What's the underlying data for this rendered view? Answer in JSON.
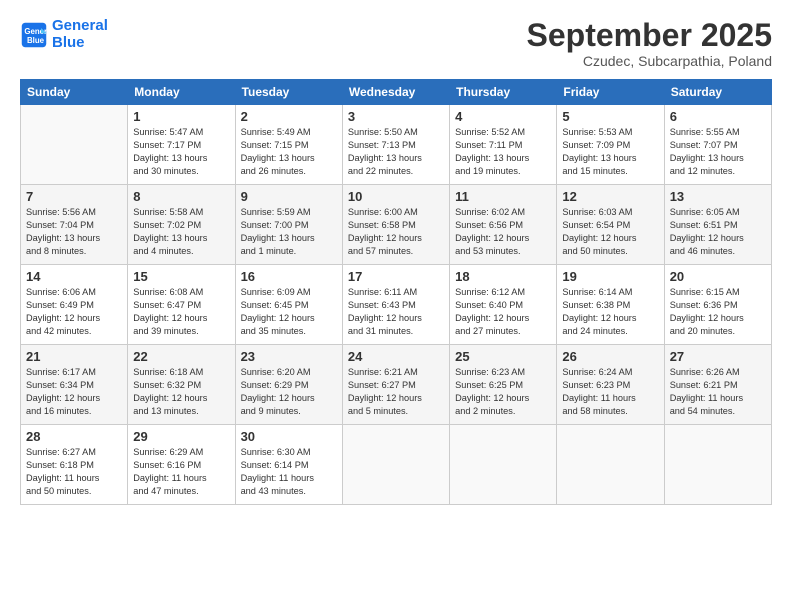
{
  "logo": {
    "line1": "General",
    "line2": "Blue"
  },
  "title": "September 2025",
  "subtitle": "Czudec, Subcarpathia, Poland",
  "days_of_week": [
    "Sunday",
    "Monday",
    "Tuesday",
    "Wednesday",
    "Thursday",
    "Friday",
    "Saturday"
  ],
  "weeks": [
    [
      {
        "day": "",
        "info": ""
      },
      {
        "day": "1",
        "info": "Sunrise: 5:47 AM\nSunset: 7:17 PM\nDaylight: 13 hours\nand 30 minutes."
      },
      {
        "day": "2",
        "info": "Sunrise: 5:49 AM\nSunset: 7:15 PM\nDaylight: 13 hours\nand 26 minutes."
      },
      {
        "day": "3",
        "info": "Sunrise: 5:50 AM\nSunset: 7:13 PM\nDaylight: 13 hours\nand 22 minutes."
      },
      {
        "day": "4",
        "info": "Sunrise: 5:52 AM\nSunset: 7:11 PM\nDaylight: 13 hours\nand 19 minutes."
      },
      {
        "day": "5",
        "info": "Sunrise: 5:53 AM\nSunset: 7:09 PM\nDaylight: 13 hours\nand 15 minutes."
      },
      {
        "day": "6",
        "info": "Sunrise: 5:55 AM\nSunset: 7:07 PM\nDaylight: 13 hours\nand 12 minutes."
      }
    ],
    [
      {
        "day": "7",
        "info": "Sunrise: 5:56 AM\nSunset: 7:04 PM\nDaylight: 13 hours\nand 8 minutes."
      },
      {
        "day": "8",
        "info": "Sunrise: 5:58 AM\nSunset: 7:02 PM\nDaylight: 13 hours\nand 4 minutes."
      },
      {
        "day": "9",
        "info": "Sunrise: 5:59 AM\nSunset: 7:00 PM\nDaylight: 13 hours\nand 1 minute."
      },
      {
        "day": "10",
        "info": "Sunrise: 6:00 AM\nSunset: 6:58 PM\nDaylight: 12 hours\nand 57 minutes."
      },
      {
        "day": "11",
        "info": "Sunrise: 6:02 AM\nSunset: 6:56 PM\nDaylight: 12 hours\nand 53 minutes."
      },
      {
        "day": "12",
        "info": "Sunrise: 6:03 AM\nSunset: 6:54 PM\nDaylight: 12 hours\nand 50 minutes."
      },
      {
        "day": "13",
        "info": "Sunrise: 6:05 AM\nSunset: 6:51 PM\nDaylight: 12 hours\nand 46 minutes."
      }
    ],
    [
      {
        "day": "14",
        "info": "Sunrise: 6:06 AM\nSunset: 6:49 PM\nDaylight: 12 hours\nand 42 minutes."
      },
      {
        "day": "15",
        "info": "Sunrise: 6:08 AM\nSunset: 6:47 PM\nDaylight: 12 hours\nand 39 minutes."
      },
      {
        "day": "16",
        "info": "Sunrise: 6:09 AM\nSunset: 6:45 PM\nDaylight: 12 hours\nand 35 minutes."
      },
      {
        "day": "17",
        "info": "Sunrise: 6:11 AM\nSunset: 6:43 PM\nDaylight: 12 hours\nand 31 minutes."
      },
      {
        "day": "18",
        "info": "Sunrise: 6:12 AM\nSunset: 6:40 PM\nDaylight: 12 hours\nand 27 minutes."
      },
      {
        "day": "19",
        "info": "Sunrise: 6:14 AM\nSunset: 6:38 PM\nDaylight: 12 hours\nand 24 minutes."
      },
      {
        "day": "20",
        "info": "Sunrise: 6:15 AM\nSunset: 6:36 PM\nDaylight: 12 hours\nand 20 minutes."
      }
    ],
    [
      {
        "day": "21",
        "info": "Sunrise: 6:17 AM\nSunset: 6:34 PM\nDaylight: 12 hours\nand 16 minutes."
      },
      {
        "day": "22",
        "info": "Sunrise: 6:18 AM\nSunset: 6:32 PM\nDaylight: 12 hours\nand 13 minutes."
      },
      {
        "day": "23",
        "info": "Sunrise: 6:20 AM\nSunset: 6:29 PM\nDaylight: 12 hours\nand 9 minutes."
      },
      {
        "day": "24",
        "info": "Sunrise: 6:21 AM\nSunset: 6:27 PM\nDaylight: 12 hours\nand 5 minutes."
      },
      {
        "day": "25",
        "info": "Sunrise: 6:23 AM\nSunset: 6:25 PM\nDaylight: 12 hours\nand 2 minutes."
      },
      {
        "day": "26",
        "info": "Sunrise: 6:24 AM\nSunset: 6:23 PM\nDaylight: 11 hours\nand 58 minutes."
      },
      {
        "day": "27",
        "info": "Sunrise: 6:26 AM\nSunset: 6:21 PM\nDaylight: 11 hours\nand 54 minutes."
      }
    ],
    [
      {
        "day": "28",
        "info": "Sunrise: 6:27 AM\nSunset: 6:18 PM\nDaylight: 11 hours\nand 50 minutes."
      },
      {
        "day": "29",
        "info": "Sunrise: 6:29 AM\nSunset: 6:16 PM\nDaylight: 11 hours\nand 47 minutes."
      },
      {
        "day": "30",
        "info": "Sunrise: 6:30 AM\nSunset: 6:14 PM\nDaylight: 11 hours\nand 43 minutes."
      },
      {
        "day": "",
        "info": ""
      },
      {
        "day": "",
        "info": ""
      },
      {
        "day": "",
        "info": ""
      },
      {
        "day": "",
        "info": ""
      }
    ]
  ]
}
